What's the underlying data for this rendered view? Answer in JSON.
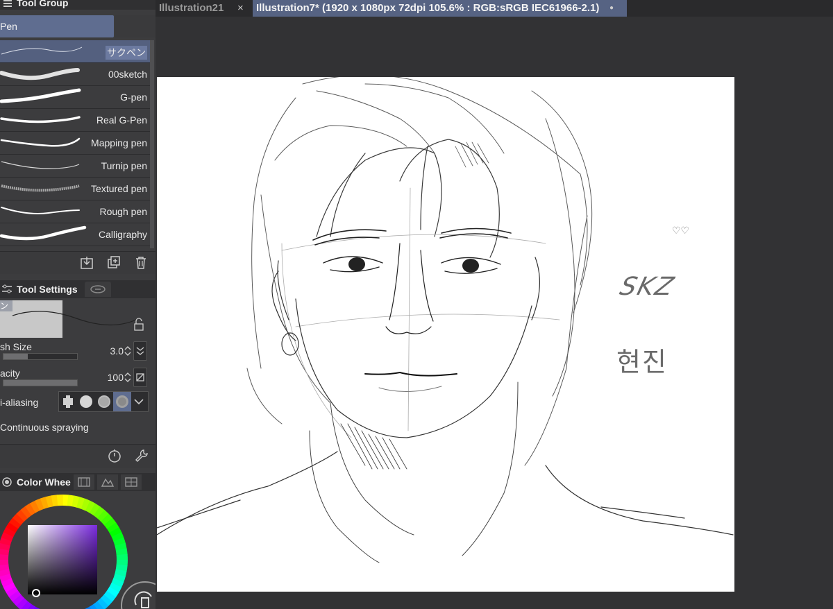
{
  "left_panel": {
    "tool_group": {
      "title": "Tool Group",
      "sub_tool": "Pen"
    },
    "brushes": [
      {
        "name": "サクペン",
        "selected": true
      },
      {
        "name": "00sketch",
        "selected": false
      },
      {
        "name": "G-pen",
        "selected": false
      },
      {
        "name": "Real G-Pen",
        "selected": false
      },
      {
        "name": "Mapping pen",
        "selected": false
      },
      {
        "name": "Turnip pen",
        "selected": false
      },
      {
        "name": "Textured pen",
        "selected": false
      },
      {
        "name": "Rough pen",
        "selected": false
      },
      {
        "name": "Calligraphy",
        "selected": false
      }
    ],
    "tool_settings": {
      "title": "Tool Settings",
      "preview_tag": "ン",
      "brush_size": {
        "label": "sh Size",
        "value": "3.0",
        "level": 0.33
      },
      "opacity": {
        "label": "acity",
        "value": "100",
        "level": 1.0
      },
      "anti_aliasing": {
        "label": "i-aliasing",
        "selected_index": 3
      },
      "continuous": {
        "label": "Continuous spraying"
      }
    },
    "color_wheel": {
      "title": "Color Whee",
      "hue_color": "#7b2be0"
    }
  },
  "tabs": [
    {
      "title": "Illustration21",
      "active": false
    },
    {
      "title": "Illustration7* (1920 x 1080px 72dpi 105.6% : RGB:sRGB IEC61966-2.1)",
      "active": true
    }
  ],
  "icons": {
    "tab_close": "×",
    "tab_modified": "●"
  },
  "canvas": {
    "signature_text": "SKZ",
    "name_text": "현진",
    "hearts": "♡♡"
  },
  "colors": {
    "accent": "#566383",
    "panel": "#3c3c3e",
    "background": "#2f2f31"
  }
}
